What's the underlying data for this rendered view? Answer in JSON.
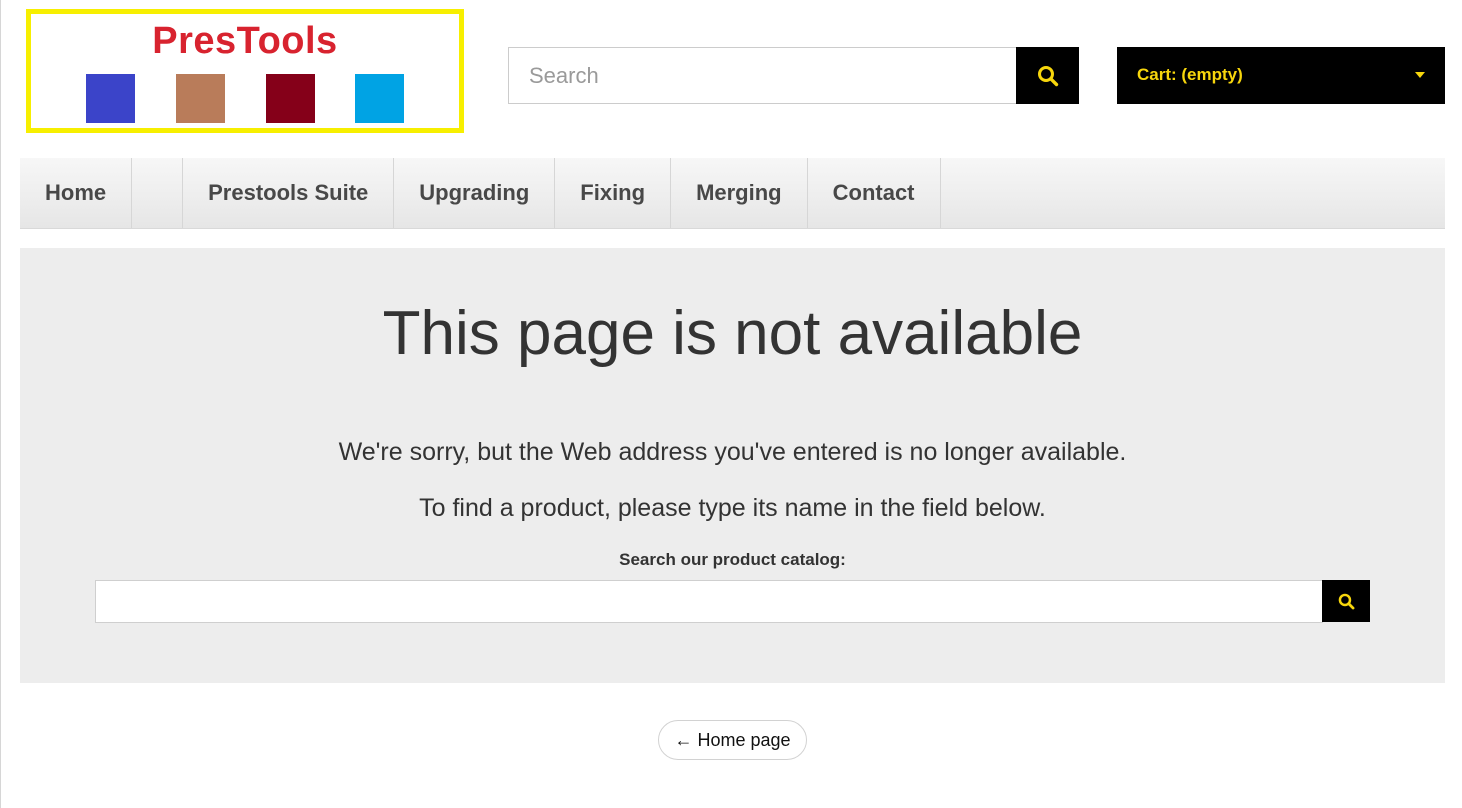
{
  "header": {
    "logo_text": "PresTools",
    "search_placeholder": "Search",
    "cart_label": "Cart: (empty)"
  },
  "nav": {
    "items": [
      {
        "label": "Home"
      },
      {
        "label": ""
      },
      {
        "label": "Prestools Suite"
      },
      {
        "label": "Upgrading"
      },
      {
        "label": "Fixing"
      },
      {
        "label": "Merging"
      },
      {
        "label": "Contact"
      }
    ]
  },
  "main": {
    "title": "This page is not available",
    "message_1": "We're sorry, but the Web address you've entered is no longer available.",
    "message_2": "To find a product, please type its name in the field below.",
    "catalog_label": "Search our product catalog:",
    "catalog_value": ""
  },
  "footer": {
    "home_arrow": "←",
    "home_label": "Home page"
  },
  "colors": {
    "accent": "#f7d60c",
    "logo_border": "#f7ef00",
    "logo_text": "#d8232f",
    "swatches": [
      "#3b44c9",
      "#b97c5a",
      "#850019",
      "#00a3e4"
    ],
    "content_bg": "#ededed"
  },
  "icons": [
    "search-icon",
    "caret-down-icon",
    "left-arrow-icon"
  ]
}
